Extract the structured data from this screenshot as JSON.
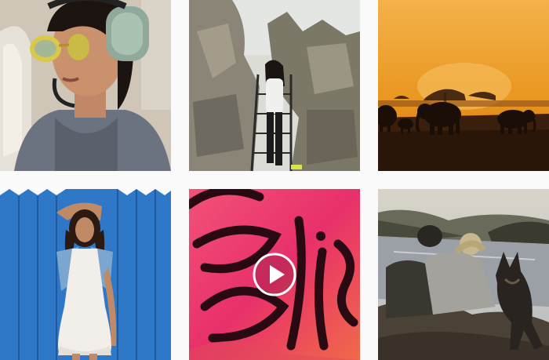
{
  "grid": {
    "background": "#fafafa",
    "posts": [
      {
        "subject": "woman-with-aviation-headset-in-plane",
        "media": "photo"
      },
      {
        "subject": "woman-on-ladder-between-rocks",
        "media": "photo"
      },
      {
        "subject": "elephants-silhouette-at-sunset",
        "media": "photo"
      },
      {
        "subject": "woman-in-white-dress-blue-wall",
        "media": "photo"
      },
      {
        "subject": "pink-bliss-lettering-mural",
        "media": "video"
      },
      {
        "subject": "couple-with-dog-overlooking-lake",
        "media": "photo"
      }
    ]
  },
  "colors": {
    "sunset_orange": "#e8961e",
    "wall_blue": "#2f78c8",
    "mural_pink": "#e8306a",
    "lake_haze": "#b8bcc0"
  },
  "icons": {
    "video_indicator": "play-icon"
  }
}
